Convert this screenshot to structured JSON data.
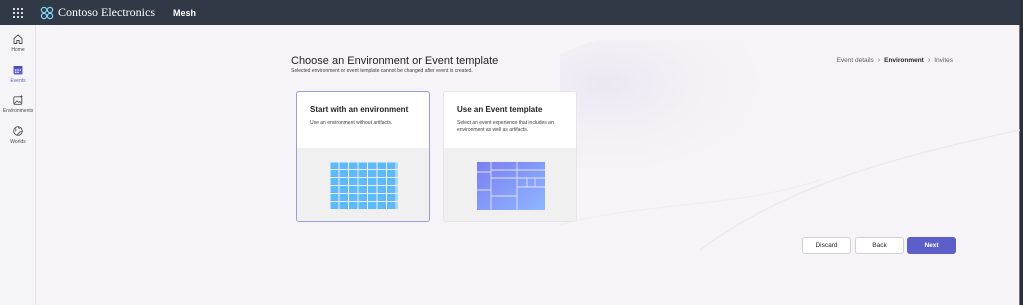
{
  "header": {
    "brand": "Contoso Electronics",
    "app": "Mesh",
    "waffle_icon": "waffle-icon",
    "brand_icon": "contoso-logo-icon"
  },
  "rail": {
    "items": [
      {
        "label": "Home",
        "icon": "home-icon",
        "active": false
      },
      {
        "label": "Events",
        "icon": "calendar-icon",
        "active": true
      },
      {
        "label": "Environments",
        "icon": "image-sparkle-icon",
        "active": false
      },
      {
        "label": "Worlds",
        "icon": "globe-icon",
        "active": false
      }
    ]
  },
  "page": {
    "title": "Choose an Environment or Event template",
    "subtitle": "Selected environment or event template cannot be changed after event is created."
  },
  "breadcrumb": {
    "steps": [
      "Event details",
      "Environment",
      "Invites"
    ],
    "current_index": 1
  },
  "cards": [
    {
      "title": "Start with an environment",
      "description": "Use an environment without artifacts.",
      "selected": true
    },
    {
      "title": "Use an Event template",
      "description": "Select an event experience that includes an environment as well as artifacts.",
      "selected": false
    }
  ],
  "actions": {
    "discard": "Discard",
    "back": "Back",
    "next": "Next"
  },
  "colors": {
    "topbar": "#313846",
    "accent": "#5b5fc7",
    "page_bg": "#f6f4f8"
  }
}
